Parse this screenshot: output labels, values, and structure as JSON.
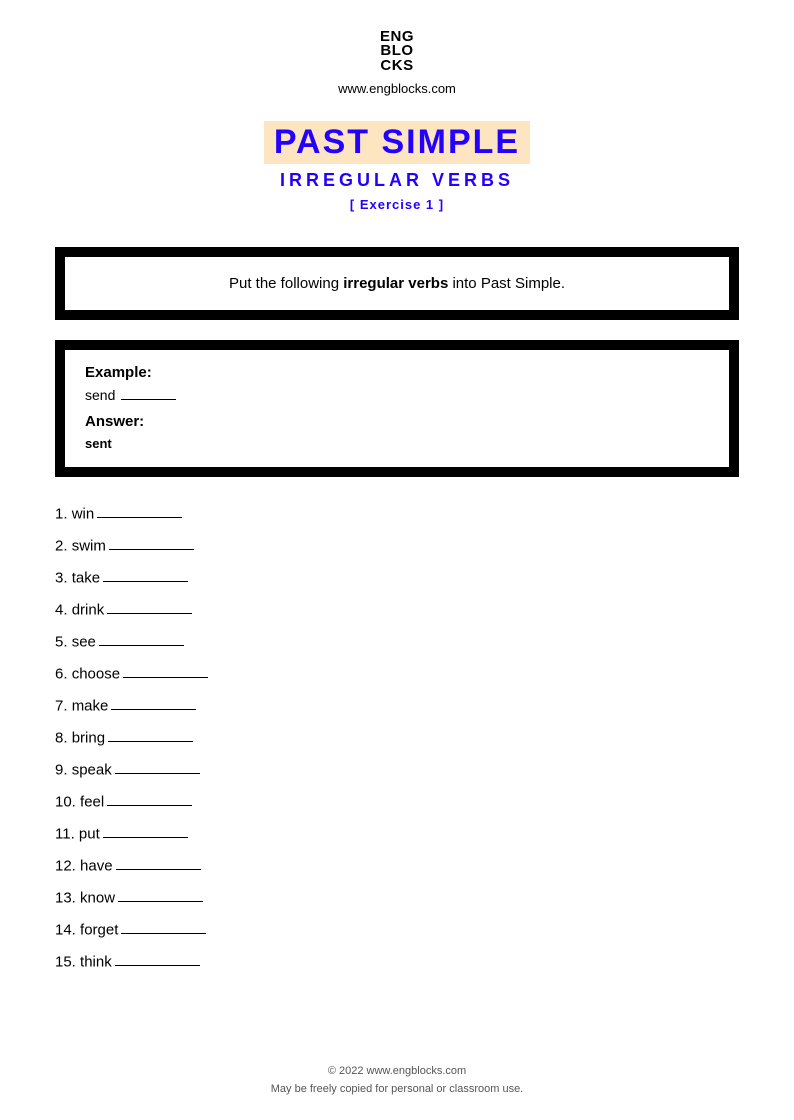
{
  "header": {
    "logo_line1": "ENG",
    "logo_line2": "BLO",
    "logo_line3": "CKS",
    "site_url": "www.engblocks.com"
  },
  "title": {
    "main": "PAST SIMPLE",
    "sub": "IRREGULAR VERBS",
    "exercise": "[ Exercise 1 ]"
  },
  "instruction": {
    "pre": "Put the following ",
    "bold": "irregular verbs",
    "post": " into Past Simple."
  },
  "example": {
    "example_label": "Example:",
    "example_word": "send",
    "answer_label": "Answer:",
    "answer_word": "sent"
  },
  "questions": [
    {
      "num": "1.",
      "word": "win"
    },
    {
      "num": "2.",
      "word": "swim"
    },
    {
      "num": "3.",
      "word": "take"
    },
    {
      "num": "4.",
      "word": "drink"
    },
    {
      "num": "5.",
      "word": "see"
    },
    {
      "num": "6.",
      "word": "choose"
    },
    {
      "num": "7.",
      "word": "make"
    },
    {
      "num": "8.",
      "word": "bring"
    },
    {
      "num": "9.",
      "word": "speak"
    },
    {
      "num": "10.",
      "word": "feel"
    },
    {
      "num": "11.",
      "word": "put"
    },
    {
      "num": "12.",
      "word": "have"
    },
    {
      "num": "13.",
      "word": "know"
    },
    {
      "num": "14.",
      "word": "forget"
    },
    {
      "num": "15.",
      "word": "think"
    }
  ],
  "footer": {
    "copyright": "© 2022 www.engblocks.com",
    "license": "May be freely copied for personal or classroom use."
  }
}
